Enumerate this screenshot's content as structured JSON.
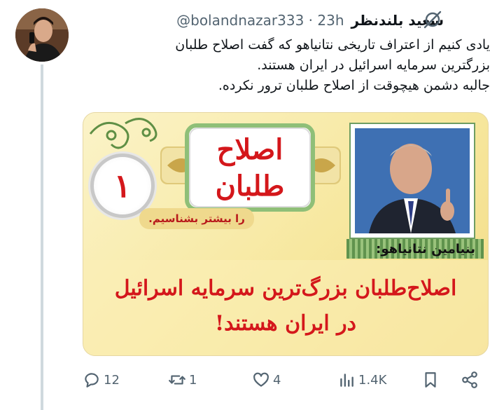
{
  "author": {
    "display_name": "سعید بلندنظر",
    "handle": "@boland­nazar333",
    "time": "23h"
  },
  "tweet": {
    "lines": [
      "یادی کنیم از اعتراف تاریخی نتانیاهو که گفت اصلاح طلبان",
      "بزرگترین سرمایه اسرائیل در ایران هستند.",
      "جالبه دشمن هیچوقت از اصلاح طلبان ترور نکرده."
    ]
  },
  "media": {
    "title_line1": "اصلاح",
    "title_line2": "طلبان",
    "number": "۱",
    "subtitle": "را بیشتر بشناسیم.",
    "author_label": "بنیامین نتانیاهو:",
    "quote_line1": "اصلاح‌طلبان بزرگ‌ترین سرمایه اسرائیل",
    "quote_line2": "در ایران هستند!"
  },
  "actions": {
    "replies": "12",
    "retweets": "1",
    "likes": "4",
    "views": "1.4K"
  },
  "colors": {
    "accent_red": "#d4171b",
    "muted": "#536471",
    "thread_line": "#cfd9de"
  }
}
